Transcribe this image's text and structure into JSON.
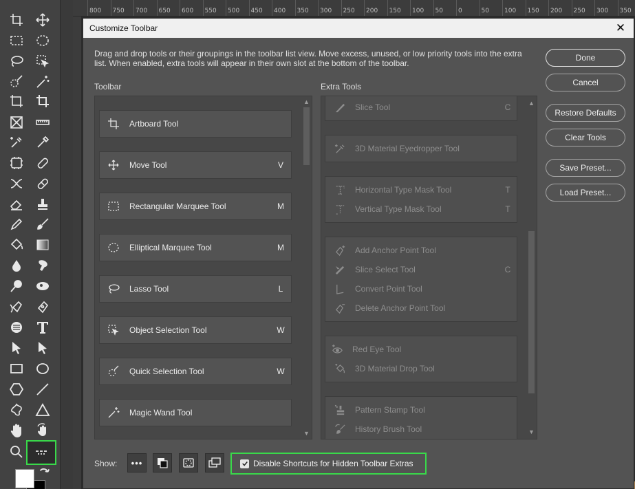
{
  "ruler": {
    "ticks": [
      "800",
      "750",
      "700",
      "650",
      "600",
      "550",
      "500",
      "450",
      "400",
      "350",
      "300",
      "250",
      "200",
      "150",
      "100",
      "50",
      "0",
      "50",
      "100",
      "150",
      "200",
      "250",
      "300",
      "350"
    ]
  },
  "dialog": {
    "title": "Customize Toolbar",
    "close_label": "✕",
    "description": "Drag and drop tools or their groupings in the toolbar list view. Move excess, unused, or low priority tools into the extra list. When enabled, extra tools will appear in their own slot at the bottom of the toolbar.",
    "toolbar_label": "Toolbar",
    "extra_label": "Extra Tools",
    "toolbar_items": [
      {
        "label": "Artboard Tool",
        "key": "",
        "icon": "artboard-icon"
      },
      {
        "label": "Move Tool",
        "key": "V",
        "icon": "move-icon"
      },
      {
        "label": "Rectangular Marquee Tool",
        "key": "M",
        "icon": "rect-marquee-icon"
      },
      {
        "label": "Elliptical Marquee Tool",
        "key": "M",
        "icon": "ellipse-marquee-icon"
      },
      {
        "label": "Lasso Tool",
        "key": "L",
        "icon": "lasso-icon"
      },
      {
        "label": "Object Selection Tool",
        "key": "W",
        "icon": "object-selection-icon"
      },
      {
        "label": "Quick Selection Tool",
        "key": "W",
        "icon": "quick-selection-icon"
      },
      {
        "label": "Magic Wand Tool",
        "key": "",
        "icon": "magic-wand-icon"
      }
    ],
    "extra_groups": [
      {
        "items": [
          {
            "label": "Slice Tool",
            "key": "C",
            "icon": "slice-icon"
          }
        ]
      },
      {
        "items": [
          {
            "label": "3D Material Eyedropper Tool",
            "key": "",
            "icon": "eyedropper-3d-icon"
          }
        ]
      },
      {
        "items": [
          {
            "label": "Horizontal Type Mask Tool",
            "key": "T",
            "icon": "h-type-mask-icon"
          },
          {
            "label": "Vertical Type Mask Tool",
            "key": "T",
            "icon": "v-type-mask-icon"
          }
        ]
      },
      {
        "items": [
          {
            "label": "Add Anchor Point Tool",
            "key": "",
            "icon": "add-anchor-icon"
          },
          {
            "label": "Slice Select Tool",
            "key": "C",
            "icon": "slice-select-icon"
          },
          {
            "label": "Convert Point Tool",
            "key": "",
            "icon": "convert-point-icon"
          },
          {
            "label": "Delete Anchor Point Tool",
            "key": "",
            "icon": "delete-anchor-icon"
          }
        ]
      },
      {
        "items": [
          {
            "label": "Red Eye Tool",
            "key": "",
            "icon": "red-eye-icon"
          },
          {
            "label": "3D Material Drop Tool",
            "key": "",
            "icon": "material-drop-icon"
          }
        ]
      },
      {
        "items": [
          {
            "label": "Pattern Stamp Tool",
            "key": "",
            "icon": "pattern-stamp-icon"
          },
          {
            "label": "History Brush Tool",
            "key": "",
            "icon": "history-brush-icon"
          }
        ]
      }
    ],
    "buttons": {
      "done": "Done",
      "cancel": "Cancel",
      "restore": "Restore Defaults",
      "clear": "Clear Tools",
      "save_preset": "Save Preset...",
      "load_preset": "Load Preset..."
    },
    "show_label": "Show:",
    "show_more_label": "•••",
    "disable_shortcuts_label": "Disable Shortcuts for Hidden Toolbar Extras",
    "disable_shortcuts_checked": true
  },
  "colors": {
    "highlight": "#39d94a",
    "dialog_bg": "#535353",
    "list_bg": "#474747"
  }
}
